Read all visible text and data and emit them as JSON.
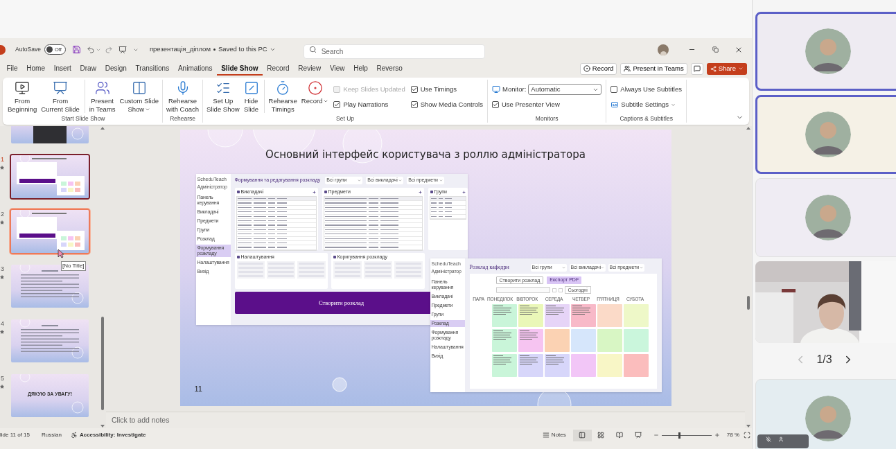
{
  "title_bar": {
    "autosave_label": "AutoSave",
    "autosave_toggle": {
      "on": false,
      "label": "Off"
    },
    "document_name": "презентація_діплом",
    "save_status": "Saved to this PC",
    "search": {
      "placeholder": "Search"
    }
  },
  "menu_tabs": [
    {
      "label": "File",
      "selected": false
    },
    {
      "label": "Home",
      "selected": false
    },
    {
      "label": "Insert",
      "selected": false
    },
    {
      "label": "Draw",
      "selected": false
    },
    {
      "label": "Design",
      "selected": false
    },
    {
      "label": "Transitions",
      "selected": false
    },
    {
      "label": "Animations",
      "selected": false
    },
    {
      "label": "Slide Show",
      "selected": true
    },
    {
      "label": "Record",
      "selected": false
    },
    {
      "label": "Review",
      "selected": false
    },
    {
      "label": "View",
      "selected": false
    },
    {
      "label": "Help",
      "selected": false
    },
    {
      "label": "Reverso",
      "selected": false
    }
  ],
  "header_buttons": [
    {
      "kind": "record",
      "label": "Record"
    },
    {
      "kind": "teams",
      "label": "Present in Teams"
    },
    {
      "kind": "comments"
    },
    {
      "kind": "share",
      "label": "Share"
    }
  ],
  "ribbon_groups": [
    {
      "label": "Start Slide Show",
      "items": [
        {
          "kind": "big",
          "label": "From\nBeginning"
        },
        {
          "kind": "big",
          "label": "From\nCurrent Slide"
        },
        {
          "kind": "big",
          "label": "Present\nin Teams",
          "divider_before": true
        },
        {
          "kind": "big",
          "label": "Custom Slide\nShow",
          "dropdown": true
        }
      ]
    },
    {
      "label": "Rehearse",
      "items": [
        {
          "kind": "big",
          "label": "Rehearse\nwith Coach"
        }
      ]
    },
    {
      "label": "Set Up",
      "items": [
        {
          "kind": "big",
          "label": "Set Up\nSlide Show"
        },
        {
          "kind": "big",
          "label": "Hide\nSlide"
        },
        {
          "kind": "big",
          "label": "Rehearse\nTimings",
          "divider_before": true
        },
        {
          "kind": "big",
          "label": "Record",
          "dropdown": true
        },
        {
          "kind": "stack",
          "rows": [
            {
              "kind": "check",
              "label": "Keep Slides Updated",
              "checked": false,
              "disabled": true
            },
            {
              "kind": "check",
              "label": "Play Narrations",
              "checked": true,
              "disabled": false
            }
          ]
        },
        {
          "kind": "stack",
          "rows": [
            {
              "kind": "check",
              "label": "Use Timings",
              "checked": true,
              "disabled": false
            },
            {
              "kind": "check",
              "label": "Show Media Controls",
              "checked": true,
              "disabled": false
            }
          ]
        }
      ]
    },
    {
      "label": "Monitors",
      "items": [
        {
          "kind": "stack",
          "rows": [
            {
              "kind": "select",
              "label": "Monitor:",
              "value": "Automatic"
            },
            {
              "kind": "check",
              "label": "Use Presenter View",
              "checked": true,
              "disabled": false
            }
          ]
        }
      ]
    },
    {
      "label": "Captions & Subtitles",
      "items": [
        {
          "kind": "stack",
          "rows": [
            {
              "kind": "check",
              "label": "Always Use Subtitles",
              "checked": false,
              "disabled": false
            },
            {
              "kind": "menu",
              "label": "Subtitle Settings"
            }
          ]
        }
      ]
    }
  ],
  "thumbnails": [
    {
      "kind": "dark_image",
      "selected": false,
      "hovered": false
    },
    {
      "number": "1",
      "kind": "screens",
      "selected": true,
      "hovered": false
    },
    {
      "number": "2",
      "kind": "screens",
      "selected": false,
      "hovered": true,
      "tooltip": "[No Title]"
    },
    {
      "number": "3",
      "kind": "text",
      "selected": false,
      "hovered": false
    },
    {
      "number": "4",
      "kind": "text",
      "selected": false,
      "hovered": false
    },
    {
      "number": "5",
      "kind": "closing",
      "text": "ДЯКУЮ ЗА УВАГУ!",
      "selected": false,
      "hovered": false
    }
  ],
  "slide": {
    "title": "Основний інтерфейс користувача з роллю адміністратора",
    "number": "11",
    "screens": [
      {
        "kind": "editor",
        "sidebar": {
          "brand": "ScheduTeach",
          "role": "Адміністратор",
          "items": [
            {
              "label": "Панель керування",
              "selected": false
            },
            {
              "label": "Викладачі",
              "selected": false
            },
            {
              "label": "Предмети",
              "selected": false
            },
            {
              "label": "Групи",
              "selected": false
            },
            {
              "label": "Розклад",
              "selected": false
            },
            {
              "label": "Формування розкладу",
              "selected": true
            },
            {
              "label": "Налаштування",
              "selected": false
            },
            {
              "label": "Вихід",
              "selected": false
            }
          ]
        },
        "heading": "Формування та редагування розкладу",
        "filters": [
          "Всі групи",
          "Всі викладачі",
          "Всі предмети"
        ],
        "panels": [
          {
            "title": "Викладачі"
          },
          {
            "title": "Предмети"
          },
          {
            "title": "Групи"
          }
        ],
        "lower_panels": [
          {
            "title": "Налаштування"
          },
          {
            "title": "Коригування розкладу"
          }
        ],
        "action": "Створити розклад"
      },
      {
        "kind": "timetable",
        "sidebar": {
          "brand": "ScheduTeach",
          "role": "Адміністратор",
          "items": [
            {
              "label": "Панель керування",
              "selected": false
            },
            {
              "label": "Викладачі",
              "selected": false
            },
            {
              "label": "Предмети",
              "selected": false
            },
            {
              "label": "Групи",
              "selected": false
            },
            {
              "label": "Розклад",
              "selected": true
            },
            {
              "label": "Формування розкладу",
              "selected": false
            },
            {
              "label": "Налаштування",
              "selected": false
            },
            {
              "label": "Вихід",
              "selected": false
            }
          ]
        },
        "heading": "Розклад кафедри",
        "filters": [
          "Всі групи",
          "Всі викладачі",
          "Всі предмети"
        ],
        "buttons": [
          {
            "label": "Створити розклад",
            "selected": false
          },
          {
            "label": "Експорт PDF",
            "selected": true
          }
        ],
        "today": "Сьогодні",
        "columns": [
          "ПАРА",
          "ПОНЕДІЛОК",
          "ВІВТОРОК",
          "СЕРЕДА",
          "ЧЕТВЕР",
          "П'ЯТНИЦЯ",
          "СУБОТА"
        ],
        "rows": [
          {
            "cells": [
              {
                "color": "#c9f5d9",
                "filled": true
              },
              {
                "color": "#eaf7b8",
                "filled": true
              },
              {
                "color": "#e6d4f7",
                "filled": true
              },
              {
                "color": "#f8b9c8",
                "filled": true
              },
              {
                "color": "#fbdac8",
                "filled": false
              },
              {
                "color": "#eef8c8",
                "filled": false
              }
            ]
          },
          {
            "cells": [
              {
                "color": "#c9f5d9",
                "filled": true
              },
              {
                "color": "#f6c4f1",
                "filled": true
              },
              {
                "color": "#fbd2b3",
                "filled": false
              },
              {
                "color": "#d6e6fb",
                "filled": false
              },
              {
                "color": "#d8f6c4",
                "filled": false
              },
              {
                "color": "#caf6dc",
                "filled": false
              }
            ]
          },
          {
            "cells": [
              {
                "color": "#c9f5d9",
                "filled": true
              },
              {
                "color": "#d7d6fa",
                "filled": true
              },
              {
                "color": "#d7d6fa",
                "filled": true
              },
              {
                "color": "#f2c6f7",
                "filled": false
              },
              {
                "color": "#f8f6c6",
                "filled": false
              },
              {
                "color": "#fbbdbd",
                "filled": false
              }
            ]
          }
        ]
      }
    ]
  },
  "notes_placeholder": "Click to add notes",
  "status_bar": {
    "slide_position": "lide 11 of 15",
    "language": "Russian",
    "accessibility": "Accessibility: Investigate",
    "notes": "Notes",
    "views": [
      {
        "selected": true
      },
      {
        "selected": false
      },
      {
        "selected": false
      },
      {
        "selected": false
      }
    ],
    "zoom": {
      "level": 0.36,
      "reading": "78 %"
    }
  },
  "call_panel": {
    "tiles": [
      {
        "kind": "avatar",
        "speaking": true,
        "color": "#eeebf2"
      },
      {
        "kind": "avatar",
        "speaking": true,
        "color": "#f5f1e6"
      },
      {
        "kind": "avatar",
        "speaking": false,
        "color": "#efecf3"
      },
      {
        "kind": "video",
        "speaking": false
      }
    ],
    "page": "1/3",
    "next_tiles": [
      {
        "kind": "avatar",
        "speaking": false,
        "color": "#e4edf1"
      }
    ]
  }
}
